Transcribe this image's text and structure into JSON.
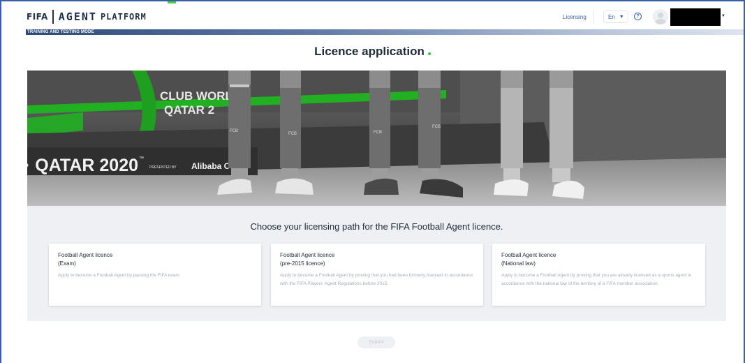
{
  "header": {
    "logo": {
      "fifa": "FIFA",
      "agent": "AGENT",
      "platform": "PLATFORM"
    },
    "nav": {
      "licensing": "Licensing"
    },
    "language": {
      "selected": "En"
    },
    "mode_banner": "TRAINING AND TESTING MODE",
    "colors": {
      "brand": "#22314a",
      "accent": "#3b5fa6",
      "green": "#4bd14b"
    }
  },
  "main": {
    "title": "Licence application",
    "hero": {
      "banner_text": "· QATAR 2020",
      "tm": "™",
      "presented": "PRESENTED BY",
      "sponsor": "Alibaba C",
      "wall_text": "CLUB WORL",
      "wall_text2": "QATAR 2",
      "sock_brand": "FCB"
    },
    "section_heading": "Choose your licensing path for the FIFA Football Agent licence.",
    "cards": [
      {
        "title": "Football Agent licence",
        "subtitle": "(Exam)",
        "description": "Apply to become a Football Agent by passing the FIFA exam."
      },
      {
        "title": "Football Agent licence",
        "subtitle": "(pre-2015 licence)",
        "description": "Apply to become a Football Agent by proving that you had been formerly licensed in accordance with the FIFA Players' Agent Regulations before 2015."
      },
      {
        "title": "Football Agent licence",
        "subtitle": "(National law)",
        "description": "Apply to become a Football Agent by proving that you are already licensed as a sports agent in accordance with the national law of the territory of a FIFA member association."
      }
    ],
    "submit_label": "Submit"
  },
  "icons": {
    "help": "help-circle-icon",
    "avatar": "user-avatar-icon",
    "chevron": "chevron-down-icon"
  }
}
